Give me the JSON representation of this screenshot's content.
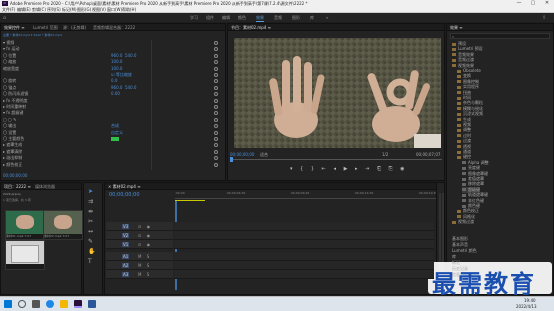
{
  "titlebar": {
    "title": "Adobe Premiere Pro 2020 - C:\\用户\\Pshop\\桌面\\素材\\素材 Premiere Pro 2020 从新手到高手\\素材 Premiere Pro 2020 从新手到高手\\第7课\\7.2.4\\源文件\\2222 *",
    "logo": "Pr",
    "minimize": "—",
    "maximize": "▢",
    "close": "✕"
  },
  "menu": [
    "文件(F)",
    "编辑(E)",
    "剪辑(C)",
    "序列(S)",
    "标记(M)",
    "图形(G)",
    "视图(V)",
    "窗口(W)",
    "帮助(H)"
  ],
  "workspaces": {
    "items": [
      "学习",
      "组件",
      "编辑",
      "颜色",
      "效果",
      "音频",
      "图形",
      "库"
    ],
    "active_index": 4,
    "more": "»"
  },
  "effect_controls": {
    "tabs": [
      "效果控件 ≡",
      "Lumetri 范围",
      "源：(无剪辑)",
      "音频剪辑混合器：2222"
    ],
    "header_path": "主要 * 素材02.mp4 ▾ 2222 * 素材02.mp4",
    "rows": [
      {
        "label": "▾ 视频"
      },
      {
        "label": "▾ fx 运动"
      },
      {
        "label": "〇 位置",
        "v1": "960.0",
        "v2": "540.0"
      },
      {
        "label": "〇 缩放",
        "v1": "100.0"
      },
      {
        "label": "   缩放宽度",
        "v1": "100.0"
      },
      {
        "label": "",
        "v1": "☑ 等比缩放"
      },
      {
        "label": "〇 旋转",
        "v1": "0.0"
      },
      {
        "label": "〇 锚点",
        "v1": "960.0",
        "v2": "540.0"
      },
      {
        "label": "〇 防闪烁滤镜",
        "v1": "0.00"
      },
      {
        "label": "▸ fx 不透明度"
      },
      {
        "label": "▸ 时间重映射"
      },
      {
        "label": "▾ fx 超级键"
      },
      {
        "label": "▢ ▢ ✎"
      },
      {
        "label": "〇 输出",
        "v1": "合成"
      },
      {
        "label": "〇 设置",
        "v1": "自定义"
      },
      {
        "label": "〇 主要颜色",
        "v1": ""
      },
      {
        "label": "▸ 遮罩生成"
      },
      {
        "label": "▸ 遮罩清除"
      },
      {
        "label": "▸ 溢出抑制"
      },
      {
        "label": "▸ 颜色校正"
      }
    ],
    "timecode": "00;00;00;00"
  },
  "program_monitor": {
    "title": "节目：素材02.mp4 ≡",
    "timecode_left": "00;00;00;00",
    "fit": "适合",
    "resolution": "1/2",
    "timecode_right": "00;00;07;07"
  },
  "project": {
    "tabs": [
      "项目：2222 ≡",
      "媒体浏览器"
    ],
    "file": "2222.prproj",
    "count": "1 项已选择，共 3 项",
    "items": [
      {
        "label": "素材01.mp4  7;07"
      },
      {
        "label": "素材02.mp4  7;07"
      },
      {
        "label": ""
      }
    ]
  },
  "timeline": {
    "title": "× 素材02.mp4 ≡",
    "timecode": "00;00;00;00",
    "ruler": [
      ":00;00",
      "00;00;04;29",
      "00;00;09;29",
      "00;00;14;29",
      "00;00;19;29"
    ],
    "tracks": [
      "V3",
      "V2",
      "V1",
      "A1",
      "A2",
      "A3"
    ],
    "master": "主声道",
    "master_val": "0.0",
    "clips": [
      {
        "label": "fx 素材02.mp4"
      },
      {
        "label": "fx 素材01.mp4"
      }
    ]
  },
  "effects": {
    "title": "效果 ≡",
    "search": "",
    "items": [
      {
        "label": "预设",
        "indent": 0
      },
      {
        "label": "Lumetri 预设",
        "indent": 0
      },
      {
        "label": "音频效果",
        "indent": 0
      },
      {
        "label": "音频过渡",
        "indent": 0
      },
      {
        "label": "视频效果",
        "indent": 0
      },
      {
        "label": "Obsolete",
        "indent": 1
      },
      {
        "label": "变换",
        "indent": 1
      },
      {
        "label": "图像控制",
        "indent": 1
      },
      {
        "label": "实用程序",
        "indent": 1
      },
      {
        "label": "扭曲",
        "indent": 1
      },
      {
        "label": "时间",
        "indent": 1
      },
      {
        "label": "杂色与颗粒",
        "indent": 1
      },
      {
        "label": "模糊与锐化",
        "indent": 1
      },
      {
        "label": "沉浸式视频",
        "indent": 1
      },
      {
        "label": "生成",
        "indent": 1
      },
      {
        "label": "视频",
        "indent": 1
      },
      {
        "label": "调整",
        "indent": 1
      },
      {
        "label": "过时",
        "indent": 1
      },
      {
        "label": "过渡",
        "indent": 1
      },
      {
        "label": "透视",
        "indent": 1
      },
      {
        "label": "通道",
        "indent": 1
      },
      {
        "label": "键控",
        "indent": 1
      },
      {
        "label": "Alpha 调整",
        "indent": 2
      },
      {
        "label": "亮度键",
        "indent": 2
      },
      {
        "label": "图像遮罩键",
        "indent": 2
      },
      {
        "label": "差值遮罩",
        "indent": 2
      },
      {
        "label": "移除遮罩",
        "indent": 2
      },
      {
        "label": "超级键",
        "indent": 2
      },
      {
        "label": "轨道遮罩键",
        "indent": 2
      },
      {
        "label": "非红色键",
        "indent": 2
      },
      {
        "label": "颜色键",
        "indent": 2
      },
      {
        "label": "颜色校正",
        "indent": 1
      },
      {
        "label": "风格化",
        "indent": 1
      },
      {
        "label": "视频过渡",
        "indent": 0
      }
    ],
    "footer": [
      "基本图形",
      "基本声音",
      "Lumetri 颜色",
      "库",
      "标记",
      "历史记录",
      "信息"
    ]
  },
  "watermark": "最需教育",
  "taskbar": {
    "time": "19:40",
    "date": "2022/4/13"
  }
}
